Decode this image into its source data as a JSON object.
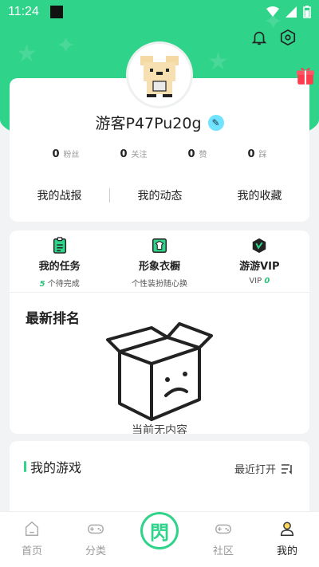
{
  "status_bar": {
    "time": "11:24"
  },
  "profile": {
    "username": "游客P47Pu20g",
    "stats": [
      {
        "num": "0",
        "label": "粉丝"
      },
      {
        "num": "0",
        "label": "关注"
      },
      {
        "num": "0",
        "label": "赞"
      },
      {
        "num": "0",
        "label": "踩"
      }
    ],
    "links": [
      "我的战报",
      "我的动态",
      "我的收藏"
    ]
  },
  "features": [
    {
      "title": "我的任务",
      "sub_highlight": "5",
      "sub": " 个待完成",
      "icon": "task-icon"
    },
    {
      "title": "形象衣橱",
      "sub_highlight": "",
      "sub": "个性装扮随心换",
      "icon": "wardrobe-icon"
    },
    {
      "title": "游游VIP",
      "sub_highlight": "0",
      "sub": "VIP ",
      "icon": "vip-icon"
    }
  ],
  "ranking": {
    "title": "最新排名",
    "empty_text": "当前无内容"
  },
  "games": {
    "title": "我的游戏",
    "sort_label": "最近打开"
  },
  "tabs": [
    {
      "label": "首页",
      "icon": "home-icon"
    },
    {
      "label": "分类",
      "icon": "gamepad-icon"
    },
    {
      "label": "",
      "icon": "center-logo-icon"
    },
    {
      "label": "社区",
      "icon": "community-icon"
    },
    {
      "label": "我的",
      "icon": "profile-icon"
    }
  ],
  "colors": {
    "accent": "#2fd38a",
    "background": "#f2f3f5"
  }
}
